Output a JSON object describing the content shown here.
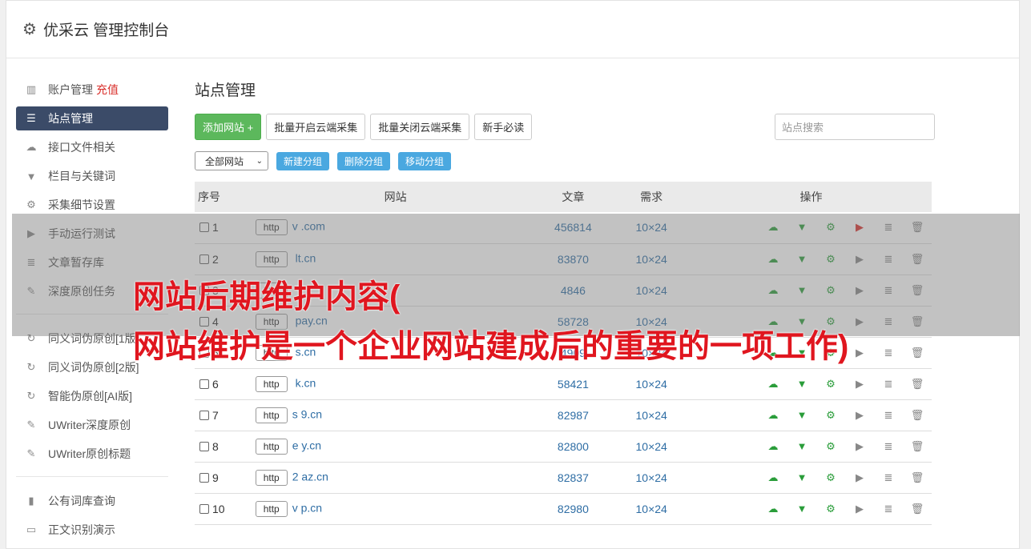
{
  "app": {
    "title": "优采云 管理控制台"
  },
  "sidebar": {
    "items": [
      {
        "label": "账户管理",
        "badge": "充值",
        "icon": "bar-chart-icon"
      },
      {
        "label": "站点管理",
        "icon": "server-icon",
        "active": true
      },
      {
        "label": "接口文件相关",
        "icon": "cloud-upload-icon"
      },
      {
        "label": "栏目与关键词",
        "icon": "filter-icon"
      },
      {
        "label": "采集细节设置",
        "icon": "cogs-icon"
      },
      {
        "label": "手动运行测试",
        "icon": "play-icon"
      },
      {
        "label": "文章暂存库",
        "icon": "database-icon"
      },
      {
        "label": "深度原创任务",
        "icon": "edit-icon"
      }
    ],
    "items2": [
      {
        "label": "同义词伪原创[1版]",
        "icon": "refresh-icon"
      },
      {
        "label": "同义词伪原创[2版]",
        "icon": "refresh-icon"
      },
      {
        "label": "智能伪原创[AI版]",
        "icon": "refresh-icon"
      },
      {
        "label": "UWriter深度原创",
        "icon": "edit-icon"
      },
      {
        "label": "UWriter原创标题",
        "icon": "edit-icon"
      }
    ],
    "items3": [
      {
        "label": "公有词库查询",
        "icon": "book-icon"
      },
      {
        "label": "正文识别演示",
        "icon": "monitor-icon"
      }
    ]
  },
  "main": {
    "title": "站点管理",
    "add_button": "添加网站 +",
    "batch_on": "批量开启云端采集",
    "batch_off": "批量关闭云端采集",
    "guide": "新手必读",
    "search_placeholder": "站点搜索",
    "group_select": "全部网站",
    "new_group": "新建分组",
    "delete_group": "删除分组",
    "move_group": "移动分组"
  },
  "table": {
    "headers": {
      "idx": "序号",
      "site": "网站",
      "articles": "文章",
      "demand": "需求",
      "ops": "操作"
    },
    "http_label": "http",
    "rows": [
      {
        "idx": "1",
        "domain": "v          .com",
        "articles": "456814",
        "demand": "10×24",
        "play_active": true
      },
      {
        "idx": "2",
        "domain": "     lt.cn",
        "articles": "83870",
        "demand": "10×24"
      },
      {
        "idx": "3",
        "domain": "",
        "articles": "4846",
        "demand": "10×24"
      },
      {
        "idx": "4",
        "domain": "     pay.cn",
        "articles": "58728",
        "demand": "10×24"
      },
      {
        "idx": "5",
        "domain": "     s.cn",
        "articles": "4909",
        "demand": "10×24"
      },
      {
        "idx": "6",
        "domain": "     k.cn",
        "articles": "58421",
        "demand": "10×24"
      },
      {
        "idx": "7",
        "domain": "s    9.cn",
        "articles": "82987",
        "demand": "10×24"
      },
      {
        "idx": "8",
        "domain": "e     y.cn",
        "articles": "82800",
        "demand": "10×24"
      },
      {
        "idx": "9",
        "domain": "2    az.cn",
        "articles": "82837",
        "demand": "10×24"
      },
      {
        "idx": "10",
        "domain": "v    p.cn",
        "articles": "82980",
        "demand": "10×24"
      }
    ]
  },
  "overlay": {
    "line1": "网站后期维护内容(",
    "line2": "网站维护是一个企业网站建成后的重要的一项工作)"
  },
  "colors": {
    "accent": "#3b4b68",
    "green": "#5cb85c",
    "headline": "#e0161f"
  }
}
